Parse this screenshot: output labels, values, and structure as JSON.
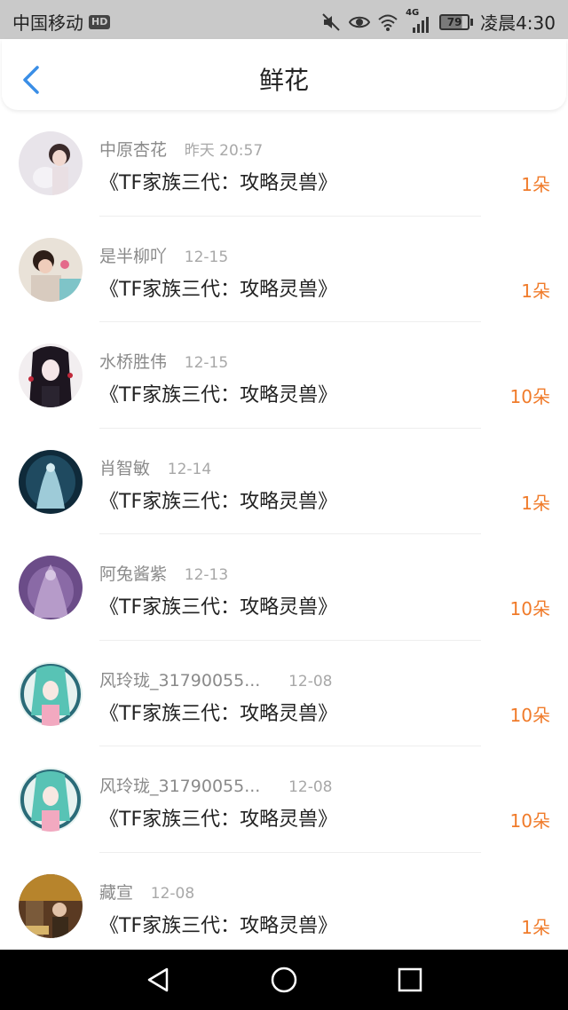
{
  "status_bar": {
    "carrier": "中国移动",
    "hd_badge": "HD",
    "network": "4G",
    "battery": "79",
    "time": "凌晨4:30",
    "icons": [
      "mute-icon",
      "eye-icon",
      "wifi-icon",
      "signal-icon"
    ]
  },
  "header": {
    "title": "鲜花",
    "back_icon": "chevron-left-icon"
  },
  "colors": {
    "accent_back": "#3a8ee6",
    "count": "#f07b2a",
    "status_bar": "#c9c9c9"
  },
  "items": [
    {
      "user": "中原杏花",
      "date": "昨天 20:57",
      "book": "《TF家族三代：攻略灵兽》",
      "count": "1朵"
    },
    {
      "user": "是半柳吖",
      "date": "12-15",
      "book": "《TF家族三代：攻略灵兽》",
      "count": "1朵"
    },
    {
      "user": "水桥胜伟",
      "date": "12-15",
      "book": "《TF家族三代：攻略灵兽》",
      "count": "10朵"
    },
    {
      "user": "肖智敏",
      "date": "12-14",
      "book": "《TF家族三代：攻略灵兽》",
      "count": "1朵"
    },
    {
      "user": "阿兔酱紫",
      "date": "12-13",
      "book": "《TF家族三代：攻略灵兽》",
      "count": "10朵"
    },
    {
      "user": "风玲珑_31790055...",
      "date": "12-08",
      "book": "《TF家族三代：攻略灵兽》",
      "count": "10朵"
    },
    {
      "user": "风玲珑_31790055...",
      "date": "12-08",
      "book": "《TF家族三代：攻略灵兽》",
      "count": "10朵"
    },
    {
      "user": "藏宣",
      "date": "12-08",
      "book": "《TF家族三代：攻略灵兽》",
      "count": "1朵"
    }
  ],
  "nav_bar": {
    "buttons": [
      "back-triangle-icon",
      "home-circle-icon",
      "recents-square-icon"
    ]
  }
}
